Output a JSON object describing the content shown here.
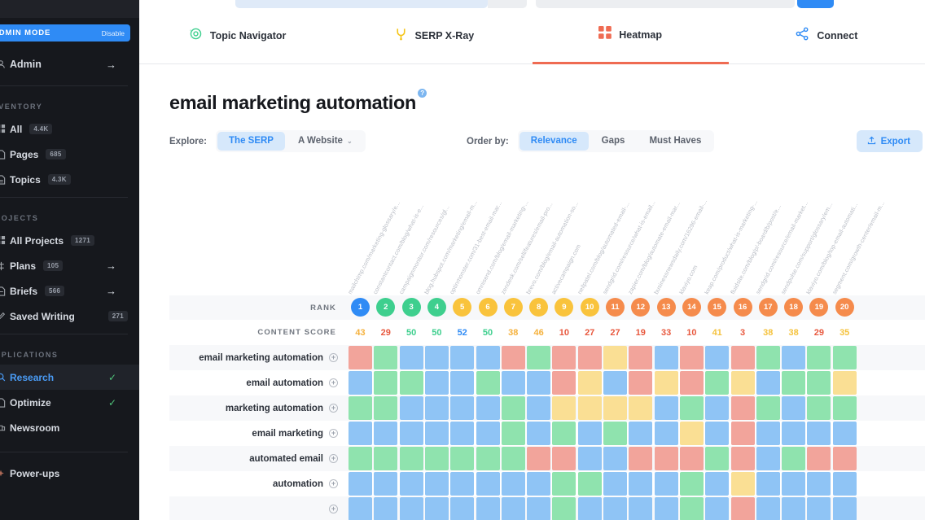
{
  "sidebar": {
    "admin_mode": {
      "label": "ADMIN MODE",
      "action": "Disable"
    },
    "user": {
      "label": "Admin",
      "icon": "avatar-icon",
      "arrow": "→"
    },
    "sections": [
      {
        "title": "INVENTORY",
        "items": [
          {
            "label": "All",
            "badge": "4.4K",
            "icon": "grid-icon",
            "arrow": ""
          },
          {
            "label": "Pages",
            "badge": "685",
            "icon": "page-icon",
            "arrow": ""
          },
          {
            "label": "Topics",
            "badge": "4.3K",
            "icon": "doc-icon",
            "arrow": ""
          }
        ]
      },
      {
        "title": "PROJECTS",
        "items": [
          {
            "label": "All Projects",
            "badge": "1271",
            "icon": "grid-icon",
            "arrow": ""
          },
          {
            "label": "Plans",
            "badge": "105",
            "icon": "plan-icon",
            "arrow": "→"
          },
          {
            "label": "Briefs",
            "badge": "566",
            "icon": "brief-icon",
            "arrow": "→"
          },
          {
            "label": "Saved Writing",
            "badge": "271",
            "icon": "pencil-icon",
            "arrow": ""
          }
        ]
      },
      {
        "title": "APPLICATIONS",
        "items": [
          {
            "label": "Research",
            "badge": "",
            "icon": "search-icon",
            "check": "✓",
            "active": true
          },
          {
            "label": "Optimize",
            "badge": "",
            "icon": "optimize-icon",
            "check": "✓"
          },
          {
            "label": "Newsroom",
            "badge": "",
            "icon": "newsroom-icon",
            "check": ""
          }
        ]
      }
    ],
    "powerups": {
      "label": "Power-ups",
      "icon": "sparkle-icon"
    }
  },
  "nav": {
    "tabs": [
      {
        "label": "Topic Navigator",
        "icon": "target-icon",
        "color": "#3ecf8e",
        "selected": false
      },
      {
        "label": "SERP X-Ray",
        "icon": "tuning-fork-icon",
        "color": "#f5c518",
        "selected": false
      },
      {
        "label": "Heatmap",
        "icon": "grid4-icon",
        "color": "#ef6b52",
        "selected": true
      },
      {
        "label": "Connect",
        "icon": "node-link-icon",
        "color": "#2f8bf5",
        "selected": false
      }
    ]
  },
  "page": {
    "title": "email marketing automation",
    "help_badge": "?"
  },
  "controls": {
    "explore_label": "Explore:",
    "explore_options": [
      {
        "label": "The SERP",
        "selected": true
      },
      {
        "label": "A Website",
        "selected": false,
        "caret": "⌄"
      }
    ],
    "order_label": "Order by:",
    "order_options": [
      {
        "label": "Relevance",
        "selected": true
      },
      {
        "label": "Gaps",
        "selected": false
      },
      {
        "label": "Must Haves",
        "selected": false
      }
    ],
    "export": {
      "label": "Export",
      "icon": "upload-icon"
    }
  },
  "chart_data": {
    "type": "heatmap",
    "title": "email marketing automation",
    "row_header_rank": "RANK",
    "row_header_score": "CONTENT SCORE",
    "columns": [
      "mailchimp.com/marketing-glossary/e...",
      "constantcontact.com/blog/what-is-e...",
      "campaignmonitor.com/resources/gl...",
      "blog.hubspot.com/marketing/email-m...",
      "optinmonster.com/31-best-email-mar...",
      "omnisend.com/blog/email-marketing-...",
      "zendesk.com/sell/features/email-pro...",
      "brevo.com/blog/email-automation-so...",
      "activecampaign.com",
      "neilpatel.com/blog/automated-email-...",
      "sendgrid.com/resource/what-is-email...",
      "zapier.com/blog/automate-email-mar...",
      "businessnewsdaily.com/16296-email-...",
      "klaviyo.com",
      "keap.com/product/what-is-marketing-...",
      "fluidsite.com/blog/p/-board/b/post/e...",
      "sendgrid.com/resource/email-market...",
      "sendpulse.com/support/glossary/em...",
      "klaviyo.com/blog/top-email-automati...",
      "segment.com/growth-center/email-m..."
    ],
    "ranks": [
      1,
      2,
      3,
      4,
      5,
      6,
      7,
      8,
      9,
      10,
      11,
      12,
      13,
      14,
      15,
      16,
      17,
      18,
      19,
      20
    ],
    "rank_colors": [
      "#2f8bf5",
      "#3ecf8e",
      "#3ecf8e",
      "#3ecf8e",
      "#f9c33c",
      "#f9c33c",
      "#f9c33c",
      "#f9c33c",
      "#f9c33c",
      "#f9c33c",
      "#f58b4c",
      "#f58b4c",
      "#f58b4c",
      "#f58b4c",
      "#f58b4c",
      "#f58b4c",
      "#f58b4c",
      "#f58b4c",
      "#f58b4c",
      "#f58b4c"
    ],
    "content_scores": [
      43,
      29,
      50,
      50,
      52,
      50,
      38,
      46,
      10,
      27,
      27,
      19,
      33,
      10,
      41,
      3,
      38,
      38,
      29,
      35
    ],
    "score_colors": [
      "#f5b13c",
      "#e8593f",
      "#3ecf8e",
      "#3ecf8e",
      "#2f8bf5",
      "#3ecf8e",
      "#f5b13c",
      "#f5b13c",
      "#e8593f",
      "#e8593f",
      "#e8593f",
      "#e8593f",
      "#e8593f",
      "#e8593f",
      "#f5c23c",
      "#e8593f",
      "#f5c23c",
      "#f5c23c",
      "#e8593f",
      "#f5c23c"
    ],
    "legend_colors": {
      "red": "#f2a49b",
      "green": "#8fe3ae",
      "blue": "#8fc4f5",
      "yellow": "#fadf94"
    },
    "rows": [
      {
        "term": "email marketing automation",
        "cells": [
          "red",
          "green",
          "blue",
          "blue",
          "blue",
          "blue",
          "red",
          "green",
          "red",
          "red",
          "yellow",
          "red",
          "blue",
          "red",
          "blue",
          "red",
          "green",
          "blue",
          "green",
          "green"
        ]
      },
      {
        "term": "email automation",
        "cells": [
          "blue",
          "green",
          "green",
          "blue",
          "blue",
          "green",
          "blue",
          "blue",
          "red",
          "yellow",
          "blue",
          "red",
          "yellow",
          "red",
          "green",
          "yellow",
          "blue",
          "green",
          "green",
          "yellow"
        ]
      },
      {
        "term": "marketing automation",
        "cells": [
          "green",
          "green",
          "blue",
          "blue",
          "blue",
          "blue",
          "green",
          "blue",
          "yellow",
          "yellow",
          "yellow",
          "yellow",
          "blue",
          "green",
          "blue",
          "red",
          "green",
          "blue",
          "green",
          "green"
        ]
      },
      {
        "term": "email marketing",
        "cells": [
          "blue",
          "blue",
          "blue",
          "blue",
          "blue",
          "blue",
          "green",
          "blue",
          "green",
          "blue",
          "green",
          "blue",
          "blue",
          "yellow",
          "blue",
          "red",
          "blue",
          "blue",
          "blue",
          "blue"
        ]
      },
      {
        "term": "automated email",
        "cells": [
          "green",
          "green",
          "green",
          "green",
          "green",
          "green",
          "green",
          "red",
          "red",
          "blue",
          "blue",
          "red",
          "red",
          "red",
          "green",
          "red",
          "blue",
          "green",
          "red",
          "red"
        ]
      },
      {
        "term": "automation",
        "cells": [
          "blue",
          "blue",
          "blue",
          "blue",
          "blue",
          "blue",
          "blue",
          "blue",
          "green",
          "green",
          "blue",
          "blue",
          "blue",
          "green",
          "blue",
          "yellow",
          "blue",
          "blue",
          "blue",
          "blue"
        ]
      },
      {
        "term": "",
        "cells": [
          "blue",
          "blue",
          "blue",
          "blue",
          "blue",
          "blue",
          "blue",
          "blue",
          "green",
          "blue",
          "blue",
          "blue",
          "blue",
          "green",
          "blue",
          "red",
          "blue",
          "blue",
          "blue",
          "blue"
        ]
      }
    ]
  }
}
